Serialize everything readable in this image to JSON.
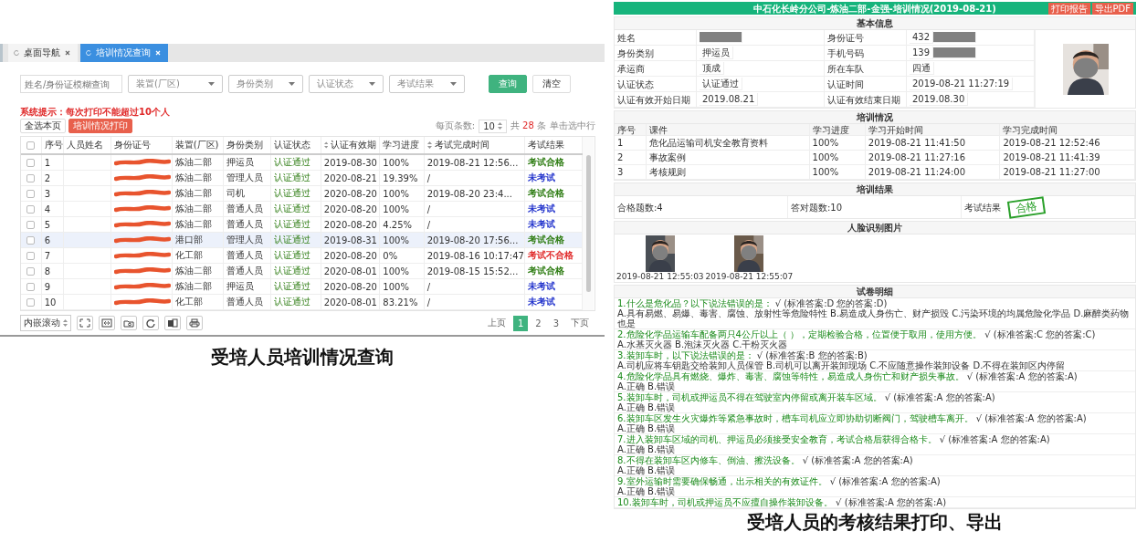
{
  "query_page": {
    "tabs": [
      {
        "label": "桌面导航",
        "selected": false
      },
      {
        "label": "培训情况查询",
        "selected": true
      }
    ],
    "filters": [
      {
        "kind": "text",
        "placeholder": "姓名/身份证模糊查询"
      },
      {
        "kind": "select",
        "placeholder": "装置(厂区)"
      },
      {
        "kind": "select",
        "placeholder": "身份类别"
      },
      {
        "kind": "select",
        "placeholder": "认证状态"
      },
      {
        "kind": "select",
        "placeholder": "考试结果"
      }
    ],
    "buttons": [
      {
        "label": "查询",
        "kind": "primary"
      },
      {
        "label": "清空",
        "kind": "plain"
      }
    ],
    "notice": "系统提示：每次打印不能超过10个人",
    "actions": [
      {
        "label": "全选本页",
        "kind": "plain"
      },
      {
        "label": "培训情况打印",
        "kind": "danger"
      }
    ],
    "page_size_label": "每页条数:",
    "page_size": "10",
    "total_prefix": "共",
    "total": "28",
    "total_suffix": "条",
    "hint": "单击选中行",
    "table": {
      "columns": [
        {
          "label": "序号",
          "sortable": false
        },
        {
          "label": "人员姓名",
          "sortable": false
        },
        {
          "label": "身份证号",
          "sortable": false
        },
        {
          "label": "装置(厂区)",
          "sortable": false
        },
        {
          "label": "身份类别",
          "sortable": false
        },
        {
          "label": "认证状态",
          "sortable": false
        },
        {
          "label": "认证有效期",
          "sortable": true
        },
        {
          "label": "学习进度",
          "sortable": false
        },
        {
          "label": "考试完成时间",
          "sortable": true
        },
        {
          "label": "考试结果",
          "sortable": false
        }
      ],
      "all_checked": false,
      "rows": [
        {
          "no": "1",
          "unit": "炼油二部",
          "identity": "押运员",
          "cert": "认证通过",
          "valid": "2019-08-30",
          "progress": "100%",
          "exam_time": "2019-08-21 12:56...",
          "result": "考试合格",
          "color": "#2f7d14",
          "checked": false,
          "selected": false
        },
        {
          "no": "2",
          "unit": "炼油二部",
          "identity": "管理人员",
          "cert": "认证通过",
          "valid": "2020-08-21",
          "progress": "19.39%",
          "exam_time": "/",
          "result": "未考试",
          "color": "#2233cc",
          "checked": false,
          "selected": false
        },
        {
          "no": "3",
          "unit": "炼油二部",
          "identity": "司机",
          "cert": "认证通过",
          "valid": "2020-08-20",
          "progress": "100%",
          "exam_time": "2019-08-20 23:4...",
          "result": "考试合格",
          "color": "#2f7d14",
          "checked": false,
          "selected": false
        },
        {
          "no": "4",
          "unit": "炼油二部",
          "identity": "普通人员",
          "cert": "认证通过",
          "valid": "2020-08-20",
          "progress": "100%",
          "exam_time": "/",
          "result": "未考试",
          "color": "#2233cc",
          "checked": false,
          "selected": false
        },
        {
          "no": "5",
          "unit": "炼油二部",
          "identity": "普通人员",
          "cert": "认证通过",
          "valid": "2020-08-20",
          "progress": "4.25%",
          "exam_time": "/",
          "result": "未考试",
          "color": "#2233cc",
          "checked": false,
          "selected": false
        },
        {
          "no": "6",
          "unit": "港口部",
          "identity": "管理人员",
          "cert": "认证通过",
          "valid": "2019-08-31",
          "progress": "100%",
          "exam_time": "2019-08-20 17:56...",
          "result": "考试合格",
          "color": "#2f7d14",
          "checked": false,
          "selected": true
        },
        {
          "no": "7",
          "unit": "化工部",
          "identity": "普通人员",
          "cert": "认证通过",
          "valid": "2020-08-20",
          "progress": "0%",
          "exam_time": "2019-08-16 10:17:47",
          "result": "考试不合格",
          "color": "#e02a2a",
          "checked": false,
          "selected": false
        },
        {
          "no": "8",
          "unit": "炼油二部",
          "identity": "普通人员",
          "cert": "认证通过",
          "valid": "2020-08-01",
          "progress": "100%",
          "exam_time": "2019-08-15 15:52...",
          "result": "考试合格",
          "color": "#2f7d14",
          "checked": false,
          "selected": false
        },
        {
          "no": "9",
          "unit": "炼油二部",
          "identity": "押运员",
          "cert": "认证通过",
          "valid": "2020-08-20",
          "progress": "100%",
          "exam_time": "/",
          "result": "未考试",
          "color": "#2233cc",
          "checked": false,
          "selected": false
        },
        {
          "no": "10",
          "unit": "化工部",
          "identity": "普通人员",
          "cert": "认证通过",
          "valid": "2020-08-01",
          "progress": "83.21%",
          "exam_time": "/",
          "result": "未考试",
          "color": "#2233cc",
          "checked": false,
          "selected": false
        }
      ]
    },
    "scroll_mode": "内嵌滚动",
    "pagination": {
      "prev": "上页",
      "pages": [
        {
          "label": "1",
          "selected": true
        },
        {
          "label": "2",
          "selected": false
        },
        {
          "label": "3",
          "selected": false
        }
      ],
      "next": "下页"
    }
  },
  "query_caption": "受培人员培训情况查询",
  "report": {
    "title": "中石化长岭分公司-炼油二部-金强-培训情况(2019-08-21)",
    "buttons": [
      "打印报告",
      "导出PDF"
    ],
    "basic": {
      "heading": "基本信息",
      "fields": [
        {
          "label": "姓名",
          "redacted": true
        },
        {
          "label": "身份证号",
          "value": "432",
          "redacted": true
        },
        {
          "label": "身份类别",
          "value": "押运员",
          "redacted": false
        },
        {
          "label": "手机号码",
          "value": "139",
          "redacted": true
        },
        {
          "label": "承运商",
          "value": "顶成",
          "redacted": false
        },
        {
          "label": "所在车队",
          "value": "四通",
          "redacted": false
        },
        {
          "label": "认证状态",
          "value": "认证通过",
          "redacted": false
        },
        {
          "label": "认证时间",
          "value": "2019-08-21 11:27:19",
          "redacted": false
        },
        {
          "label": "认证有效开始日期",
          "value": "2019.08.21",
          "redacted": false
        },
        {
          "label": "认证有效结束日期",
          "value": "2019.08.30",
          "redacted": false
        }
      ]
    },
    "training": {
      "heading": "培训情况",
      "columns": [
        "序号",
        "课件",
        "学习进度",
        "学习开始时间",
        "学习完成时间"
      ],
      "rows": [
        [
          "1",
          "危化品运输司机安全教育资料",
          "100%",
          "2019-08-21 11:41:50",
          "2019-08-21 12:52:46"
        ],
        [
          "2",
          "事故案例",
          "100%",
          "2019-08-21 11:27:16",
          "2019-08-21 11:41:39"
        ],
        [
          "3",
          "考核规则",
          "100%",
          "2019-08-21 11:24:00",
          "2019-08-21 11:27:00"
        ]
      ]
    },
    "result": {
      "heading": "培训结果",
      "items": [
        "合格题数:4",
        "答对题数:10"
      ],
      "result_label": "考试结果",
      "stamp": "合格"
    },
    "faces": {
      "heading": "人脸识别图片",
      "photos": [
        {
          "caption": "2019-08-21 12:55:03"
        },
        {
          "caption": "2019-08-21 12:55:07"
        }
      ]
    },
    "exam": {
      "heading": "试卷明细",
      "questions": [
        {
          "text": "1.什么是危化品？以下说法错误的是：",
          "correct": true,
          "mark": "√",
          "answer": "(标准答案:D 您的答案:D)",
          "options": "A.具有易燃、易爆、毒害、腐蚀、放射性等危险特性 B.易造成人身伤亡、财产损毁 C.污染环境的均属危险化学品 D.麻醉类药物也是"
        },
        {
          "text": "2.危险化学品运输车配备两只4公斤以上（ ），定期检验合格，位置便于取用，使用方便。",
          "correct": true,
          "mark": "√",
          "answer": "(标准答案:C 您的答案:C)",
          "options": "A.水基灭火器 B.泡沫灭火器 C.干粉灭火器"
        },
        {
          "text": "3.装卸车时，以下说法错误的是：",
          "correct": true,
          "mark": "√",
          "answer": "(标准答案:B 您的答案:B)",
          "options": "A.司机应将车钥匙交给装卸人员保管 B.司机可以离开装卸现场 C.不应随意操作装卸设备 D.不得在装卸区内停留"
        },
        {
          "text": "4.危险化学品具有燃烧、爆炸、毒害、腐蚀等特性，易造成人身伤亡和财产损失事故。",
          "correct": true,
          "mark": "√",
          "answer": "(标准答案:A 您的答案:A)",
          "options": "A.正确 B.错误"
        },
        {
          "text": "5.装卸车时，司机或押运员不得在驾驶室内停留或离开装车区域。",
          "correct": true,
          "mark": "√",
          "answer": "(标准答案:A 您的答案:A)",
          "options": "A.正确 B.错误"
        },
        {
          "text": "6.装卸车区发生火灾爆炸等紧急事故时，槽车司机应立即协助切断阀门，驾驶槽车离开。",
          "correct": true,
          "mark": "√",
          "answer": "(标准答案:A 您的答案:A)",
          "options": "A.正确 B.错误"
        },
        {
          "text": "7.进入装卸车区域的司机、押运员必须接受安全教育，考试合格后获得合格卡。",
          "correct": true,
          "mark": "√",
          "answer": "(标准答案:A 您的答案:A)",
          "options": "A.正确 B.错误"
        },
        {
          "text": "8.不得在装卸车区内修车、倒油、擦洗设备。",
          "correct": true,
          "mark": "√",
          "answer": "(标准答案:A 您的答案:A)",
          "options": "A.正确 B.错误"
        },
        {
          "text": "9.室外运输时需要确保畅通，出示相关的有效证件。",
          "correct": true,
          "mark": "√",
          "answer": "(标准答案:A 您的答案:A)",
          "options": "A.正确 B.错误"
        },
        {
          "text": "10.装卸车时，司机或押运员不应擅自操作装卸设备。",
          "correct": true,
          "mark": "√",
          "answer": "(标准答案:A 您的答案:A)"
        }
      ]
    }
  },
  "report_caption": "受培人员的考核结果打印、导出"
}
